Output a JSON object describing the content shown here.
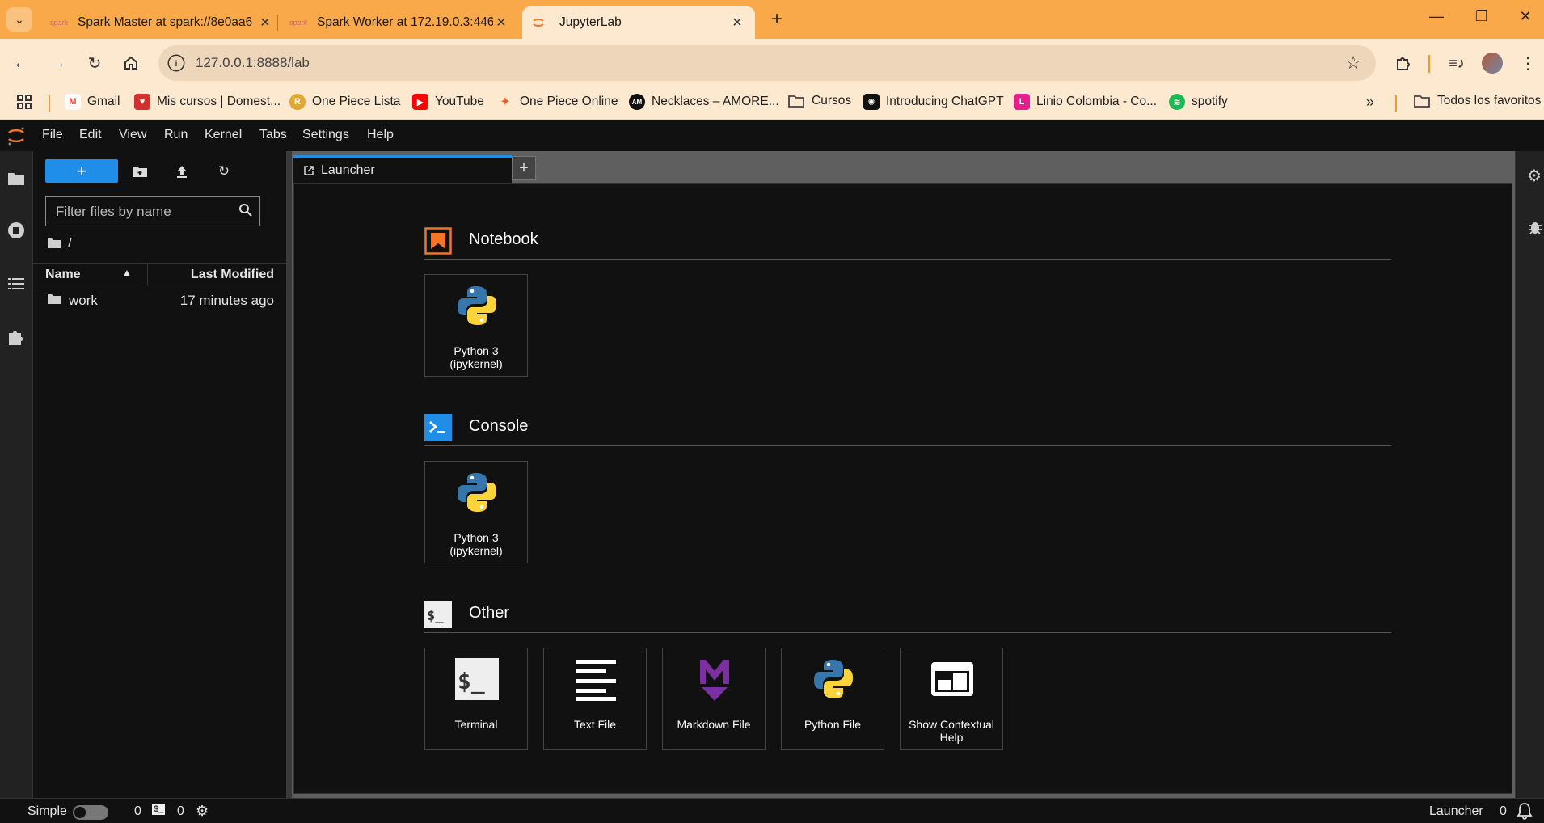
{
  "browser": {
    "tabs": [
      {
        "title": "Spark Master at spark://8e0aa6",
        "favicon": "spark-icon"
      },
      {
        "title": "Spark Worker at 172.19.0.3:446",
        "favicon": "spark-icon"
      },
      {
        "title": "JupyterLab",
        "favicon": "jupyter-icon",
        "active": true
      }
    ],
    "url": "127.0.0.1:8888/lab",
    "bookmarks": [
      {
        "label": "Gmail",
        "icon": "gmail-icon",
        "color": "#ea4335"
      },
      {
        "label": "Mis cursos | Domest...",
        "icon": "domestika-icon",
        "color": "#d32f2f"
      },
      {
        "label": "One Piece Lista",
        "icon": "r-icon",
        "color": "#e0a82e"
      },
      {
        "label": "YouTube",
        "icon": "youtube-icon",
        "color": "#ff0000"
      },
      {
        "label": "One Piece Online",
        "icon": "onepiece-icon",
        "color": "#f05a28"
      },
      {
        "label": "Necklaces – AMORE...",
        "icon": "am-icon",
        "color": "#111111"
      },
      {
        "label": "Cursos",
        "icon": "folder-icon",
        "color": "#555555"
      },
      {
        "label": "Introducing ChatGPT",
        "icon": "chatgpt-icon",
        "color": "#111111"
      },
      {
        "label": "Linio Colombia - Co...",
        "icon": "linio-icon",
        "color": "#e91e8c"
      },
      {
        "label": "spotify",
        "icon": "spotify-icon",
        "color": "#1db954"
      }
    ],
    "all_bookmarks_label": "Todos los favoritos"
  },
  "jupyter": {
    "menu": [
      "File",
      "Edit",
      "View",
      "Run",
      "Kernel",
      "Tabs",
      "Settings",
      "Help"
    ],
    "filebrowser": {
      "filter_placeholder": "Filter files by name",
      "breadcrumb": "/",
      "col_name": "Name",
      "col_modified": "Last Modified",
      "files": [
        {
          "name": "work",
          "modified": "17 minutes ago",
          "type": "folder"
        }
      ]
    },
    "launcher_tab": "Launcher",
    "sections": {
      "notebook": {
        "title": "Notebook",
        "cards": [
          {
            "label": "Python 3 (ipykernel)"
          }
        ]
      },
      "console": {
        "title": "Console",
        "cards": [
          {
            "label": "Python 3 (ipykernel)"
          }
        ]
      },
      "other": {
        "title": "Other",
        "cards": [
          {
            "label": "Terminal"
          },
          {
            "label": "Text File"
          },
          {
            "label": "Markdown File"
          },
          {
            "label": "Python File"
          },
          {
            "label": "Show Contextual Help"
          }
        ]
      }
    },
    "status": {
      "mode_label": "Simple",
      "terminals_count": "0",
      "kernels_count": "0",
      "right_label": "Launcher",
      "notifications_count": "0"
    }
  },
  "colors": {
    "accent": "#1f8ee9",
    "jupyter_orange": "#f37626",
    "tabbar": "#f9a94a"
  }
}
